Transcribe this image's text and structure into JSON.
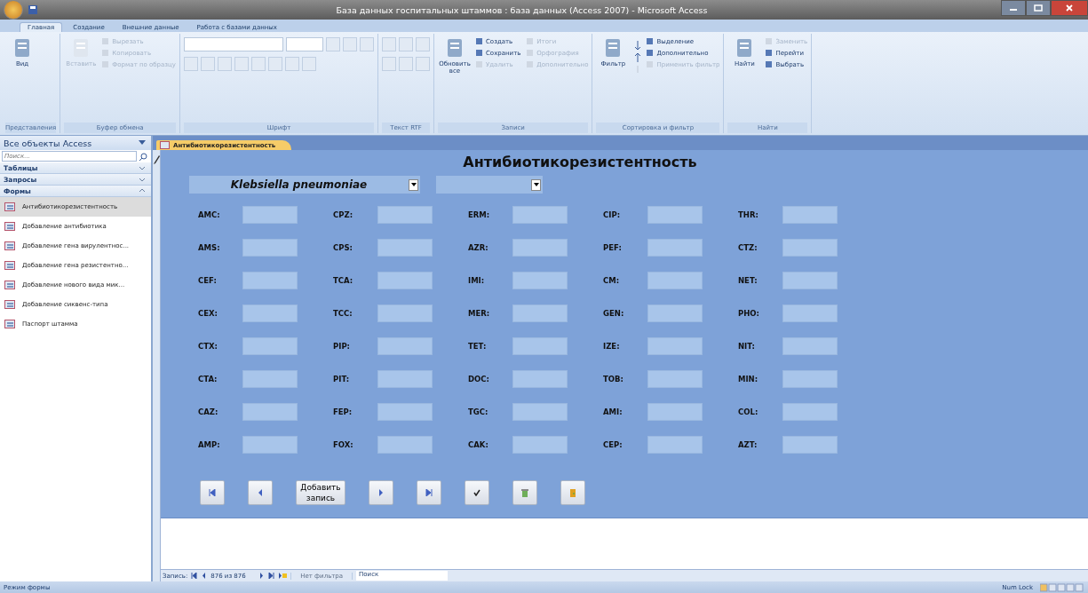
{
  "window": {
    "title": "База данных госпитальных штаммов : база данных (Access 2007) - Microsoft Access"
  },
  "ribbon_tabs": [
    {
      "label": "Главная",
      "selected": true
    },
    {
      "label": "Создание",
      "selected": false
    },
    {
      "label": "Внешние данные",
      "selected": false
    },
    {
      "label": "Работа с базами данных",
      "selected": false
    }
  ],
  "ribbon_groups": [
    {
      "label": "Представления",
      "large": [
        {
          "label": "Вид",
          "disabled": false
        }
      ]
    },
    {
      "label": "Буфер обмена",
      "large": [
        {
          "label": "Вставить",
          "disabled": true
        }
      ],
      "small": [
        {
          "label": "Вырезать",
          "disabled": true
        },
        {
          "label": "Копировать",
          "disabled": true
        },
        {
          "label": "Формат по образцу",
          "disabled": true
        }
      ]
    },
    {
      "label": "Шрифт",
      "kind": "font"
    },
    {
      "label": "Текст RTF",
      "kind": "rtf"
    },
    {
      "label": "Записи",
      "large": [
        {
          "label": "Обновить все",
          "disabled": false
        }
      ],
      "small": [
        {
          "label": "Создать",
          "disabled": false
        },
        {
          "label": "Сохранить",
          "disabled": false
        },
        {
          "label": "Удалить",
          "disabled": true
        },
        {
          "label": "Итоги",
          "disabled": true
        },
        {
          "label": "Орфография",
          "disabled": true
        },
        {
          "label": "Дополнительно",
          "disabled": true
        }
      ]
    },
    {
      "label": "Сортировка и фильтр",
      "kind": "sort",
      "large": [
        {
          "label": "Фильтр",
          "disabled": false
        }
      ],
      "small": [
        {
          "label": "Выделение",
          "disabled": false
        },
        {
          "label": "Дополнительно",
          "disabled": false
        },
        {
          "label": "Применить фильтр",
          "disabled": true
        }
      ]
    },
    {
      "label": "Найти",
      "large": [
        {
          "label": "Найти",
          "disabled": false
        }
      ],
      "small": [
        {
          "label": "Заменить",
          "disabled": true
        },
        {
          "label": "Перейти",
          "disabled": false
        },
        {
          "label": "Выбрать",
          "disabled": false
        }
      ]
    }
  ],
  "nav_pane": {
    "title": "Все объекты Access",
    "search": {
      "placeholder": "Поиск..."
    },
    "groups": [
      {
        "label": "Таблицы",
        "expanded": false
      },
      {
        "label": "Запросы",
        "expanded": false
      },
      {
        "label": "Формы",
        "expanded": true,
        "items": [
          {
            "label": "Антибиотикорезистентность",
            "selected": true
          },
          {
            "label": "Добавление антибиотика",
            "selected": false
          },
          {
            "label": "Добавление гена вирулентнос...",
            "selected": false
          },
          {
            "label": "Добавление гена резистентно...",
            "selected": false
          },
          {
            "label": "Добавление нового вида мик...",
            "selected": false
          },
          {
            "label": "Добавление сиквенс-типа",
            "selected": false
          },
          {
            "label": "Паспорт штамма",
            "selected": false
          }
        ]
      }
    ]
  },
  "document_tab": {
    "label": "Антибиотикорезистентность"
  },
  "form": {
    "title": "Антибиотикорезистентность",
    "species_combo": {
      "value": "Klebsiella pneumoniae"
    },
    "fields": [
      "AMC:",
      "CPZ:",
      "ERM:",
      "CIP:",
      "THR:",
      "AMS:",
      "CPS:",
      "AZR:",
      "PEF:",
      "CTZ:",
      "CEF:",
      "TCA:",
      "IMI:",
      "CM:",
      "NET:",
      "CEX:",
      "TCC:",
      "MER:",
      "GEN:",
      "PHO:",
      "CTX:",
      "PIP:",
      "TET:",
      "IZE:",
      "NIT:",
      "CTA:",
      "PIT:",
      "DOC:",
      "TOB:",
      "MIN:",
      "CAZ:",
      "FEP:",
      "TGC:",
      "AMI:",
      "COL:",
      "AMP:",
      "FOX:",
      "CAK:",
      "CEP:",
      "AZT:"
    ],
    "buttons": [
      {
        "kind": "first"
      },
      {
        "kind": "prev"
      },
      {
        "kind": "text",
        "label": "Добавить запись"
      },
      {
        "kind": "next"
      },
      {
        "kind": "last"
      },
      {
        "kind": "save"
      },
      {
        "kind": "delete"
      },
      {
        "kind": "close"
      }
    ]
  },
  "record_nav": {
    "label": "Запись:",
    "position": "876 из 876",
    "filter": "Нет фильтра",
    "search": "Поиск"
  },
  "status_bar": {
    "mode": "Режим формы",
    "num_lock": "Num Lock"
  }
}
